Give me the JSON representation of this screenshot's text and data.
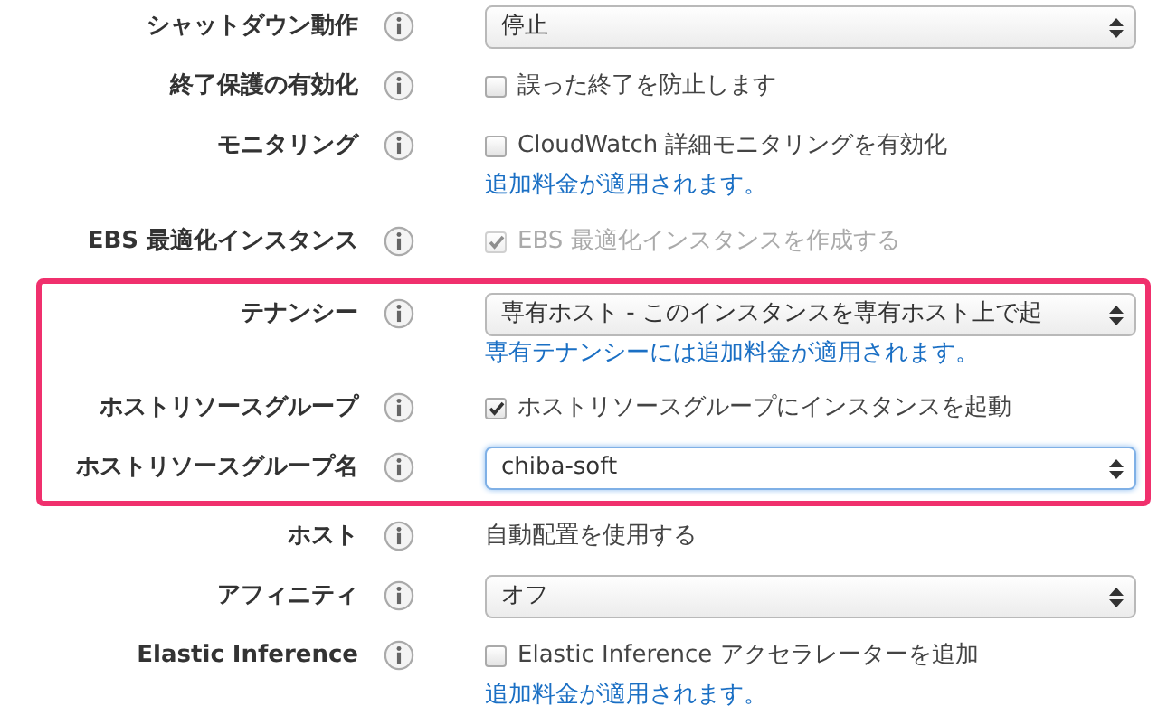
{
  "sections": [
    {
      "highlighted": false,
      "rows": [
        {
          "label": "シャットダウン動作",
          "kind": "select",
          "value": "停止",
          "focused": false
        },
        {
          "label": "終了保護の有効化",
          "kind": "checkbox",
          "text": "誤った終了を防止します",
          "checked": false,
          "disabled": false
        },
        {
          "label": "モニタリング",
          "kind": "checkbox",
          "text": "CloudWatch 詳細モニタリングを有効化",
          "checked": false,
          "disabled": false,
          "note": "追加料金が適用されます。"
        },
        {
          "label": "EBS 最適化インスタンス",
          "kind": "checkbox",
          "text": "EBS 最適化インスタンスを作成する",
          "checked": true,
          "disabled": true
        }
      ]
    },
    {
      "highlighted": true,
      "rows": [
        {
          "label": "テナンシー",
          "kind": "select",
          "value": "専有ホスト - このインスタンスを専有ホスト上で起",
          "focused": false,
          "note": "専有テナンシーには追加料金が適用されます。"
        },
        {
          "label": "ホストリソースグループ",
          "kind": "checkbox",
          "text": "ホストリソースグループにインスタンスを起動",
          "checked": true,
          "disabled": false
        },
        {
          "label": "ホストリソースグループ名",
          "kind": "select",
          "value": "chiba-soft",
          "focused": true
        }
      ]
    },
    {
      "highlighted": false,
      "rows": [
        {
          "label": "ホスト",
          "kind": "text",
          "value": "自動配置を使用する"
        },
        {
          "label": "アフィニティ",
          "kind": "select",
          "value": "オフ",
          "focused": false
        },
        {
          "label": "Elastic Inference",
          "kind": "checkbox",
          "text": "Elastic Inference アクセラレーターを追加",
          "checked": false,
          "disabled": false,
          "note": "追加料金が適用されます。"
        }
      ]
    }
  ]
}
